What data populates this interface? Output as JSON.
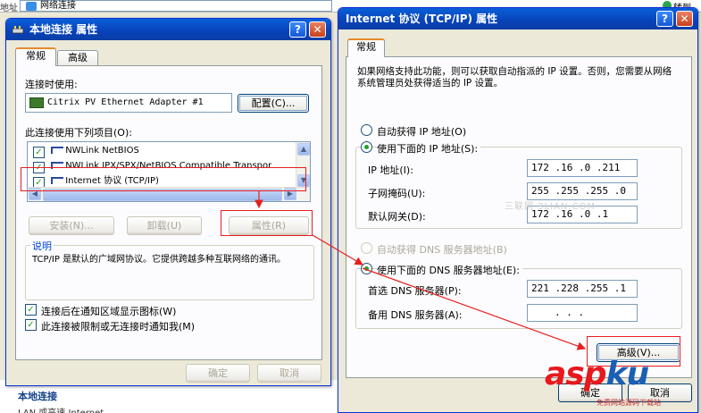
{
  "background": {
    "address_label": "地址",
    "address_value": "网络连接",
    "go_label": "转到",
    "pane_title": "本地连接",
    "pane_sub": "LAN 或高速 Internet"
  },
  "left_dialog": {
    "title": "本地连接 属性",
    "help": "?",
    "close": "✕",
    "tabs": [
      "常规",
      "高级"
    ],
    "connect_using_label": "连接时使用:",
    "adapter_name": "Citrix PV Ethernet Adapter #1",
    "configure_button": "配置(C)...",
    "items_label": "此连接使用下列项目(O):",
    "items": [
      {
        "label": "NWLink NetBIOS",
        "checked": true
      },
      {
        "label": "NWLink IPX/SPX/NetBIOS Compatible Transpor",
        "checked": true
      },
      {
        "label": "Internet 协议 (TCP/IP)",
        "checked": true
      }
    ],
    "install_button": "安装(N)...",
    "uninstall_button": "卸载(U)",
    "properties_button": "属性(R)",
    "description_label": "说明",
    "description_text": "TCP/IP 是默认的广域网协议。它提供跨越多种互联网络的通讯。",
    "show_icon_label": "连接后在通知区域显示图标(W)",
    "notify_label": "此连接被限制或无连接时通知我(M)",
    "show_icon_checked": true,
    "notify_checked": true,
    "ok_button": "确定",
    "cancel_button": "取消"
  },
  "right_dialog": {
    "title": "Internet 协议 (TCP/IP) 属性",
    "help": "?",
    "close": "✕",
    "tab": "常规",
    "intro": "如果网络支持此功能，则可以获取自动指派的 IP 设置。否则，您需要从网络系统管理员处获得适当的 IP 设置。",
    "auto_ip_label": "自动获得 IP 地址(O)",
    "manual_ip_label": "使用下面的 IP 地址(S):",
    "ip_address_label": "IP 地址(I):",
    "ip_address_value": "172 .16 .0 .211",
    "subnet_label": "子网掩码(U):",
    "subnet_value": "255 .255 .255 .0",
    "gateway_label": "默认网关(D):",
    "gateway_value": "172 .16 .0 .1",
    "auto_dns_label": "自动获得 DNS 服务器地址(B)",
    "manual_dns_label": "使用下面的 DNS 服务器地址(E):",
    "preferred_dns_label": "首选 DNS 服务器(P):",
    "preferred_dns_value": "221 .228 .255 .1",
    "alternate_dns_label": "备用 DNS 服务器(A):",
    "alternate_dns_value": ".   .   .",
    "advanced_button": "高级(V)...",
    "ok_button": "确定",
    "cancel_button": "取消"
  },
  "watermark": {
    "asp": "asp",
    "ku": "ku",
    "sub": "免费网站源码下载站",
    "faint": "三联网 3LIAN.COM"
  },
  "colors": {
    "annotation_red": "#e81f1f",
    "titlebar_blue": "#0842b8",
    "dialog_face": "#ece9d8"
  }
}
